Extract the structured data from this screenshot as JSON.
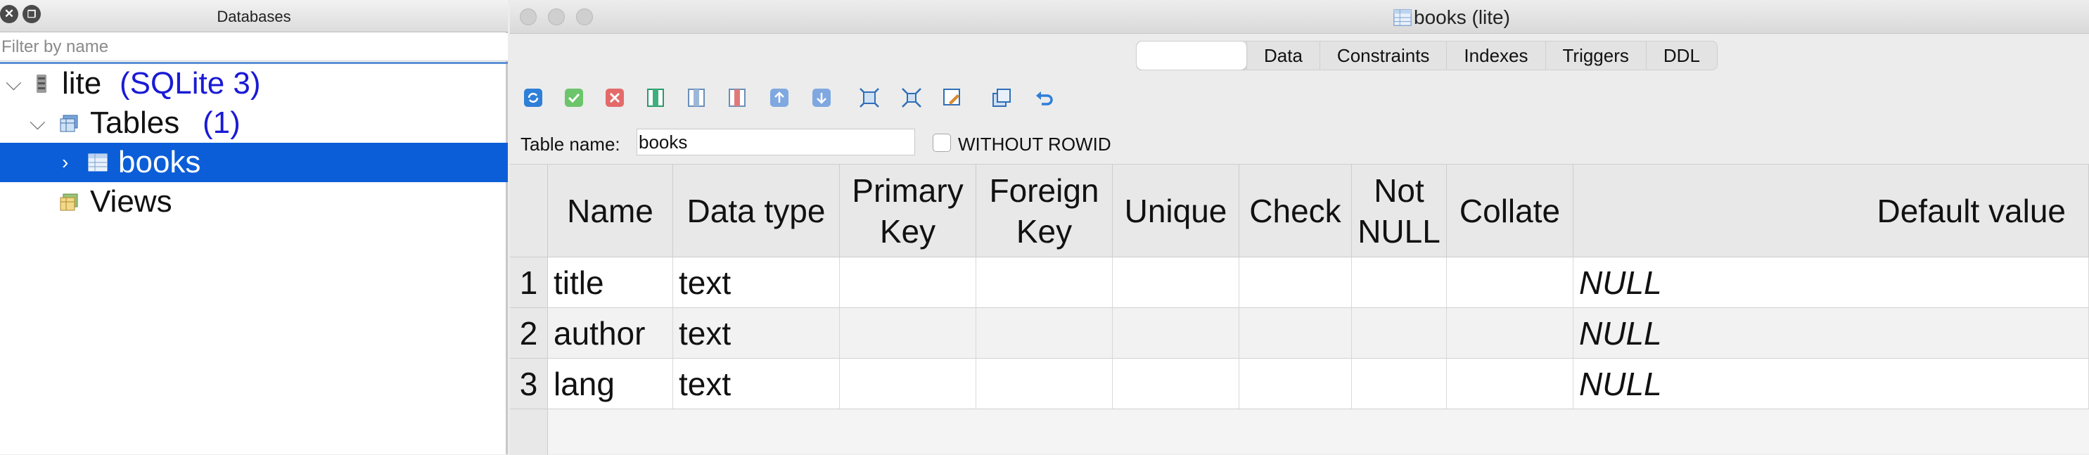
{
  "left_panel": {
    "title": "Databases",
    "filter_placeholder": "Filter by name",
    "tree": {
      "db_name": "lite",
      "db_type": "(SQLite 3)",
      "tables_label": "Tables",
      "tables_count": "(1)",
      "table_name": "books",
      "views_label": "Views"
    }
  },
  "window": {
    "title": "books (lite)",
    "tabs": [
      "",
      "Data",
      "Constraints",
      "Indexes",
      "Triggers",
      "DDL"
    ],
    "table_name_label": "Table name:",
    "table_name_value": "books",
    "without_rowid_label": "WITHOUT ROWID",
    "without_rowid_checked": false,
    "toolbar_icons": [
      "refresh-icon",
      "apply-icon",
      "cancel-icon",
      "add-column-icon",
      "insert-column-icon",
      "delete-column-icon",
      "move-up-icon",
      "move-down-icon",
      "fit-columns-icon",
      "shrink-columns-icon",
      "edit-icon",
      "copy-icon",
      "undo-icon"
    ]
  },
  "grid": {
    "columns": [
      "Name",
      "Data type",
      "Primary Key",
      "Foreign Key",
      "Unique",
      "Check",
      "Not NULL",
      "Collate",
      "Default value"
    ],
    "rows": [
      {
        "num": "1",
        "name": "title",
        "type": "text",
        "default": "NULL"
      },
      {
        "num": "2",
        "name": "author",
        "type": "text",
        "default": "NULL"
      },
      {
        "num": "3",
        "name": "lang",
        "type": "text",
        "default": "NULL"
      }
    ]
  },
  "colors": {
    "selection": "#0b5ed7",
    "db_type_text": "#1a1ad6",
    "accent_border": "#5c8fd6"
  }
}
